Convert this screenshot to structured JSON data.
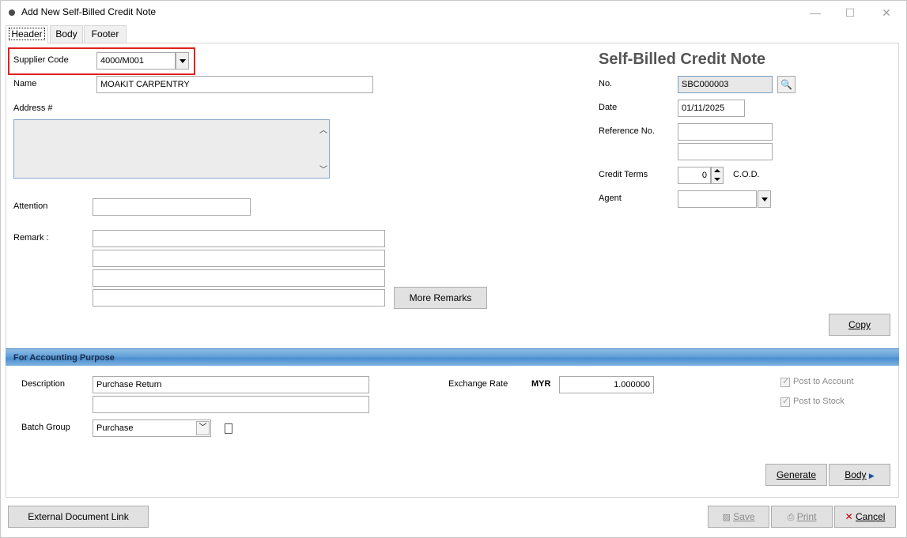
{
  "window": {
    "title": "Add New Self-Billed Credit Note",
    "minimize": "—",
    "maximize": "☐",
    "close": "✕"
  },
  "tabs": [
    {
      "label": "Header",
      "active": true
    },
    {
      "label": "Body",
      "active": false
    },
    {
      "label": "Footer",
      "active": false
    }
  ],
  "header": {
    "doc_title": "Self-Billed Credit Note",
    "supplier_code_label": "Supplier Code",
    "supplier_code_value": "4000/M001",
    "name_label": "Name",
    "name_value": "MOAKIT CARPENTRY",
    "address_label": "Address #",
    "attention_label": "Attention",
    "remark_label": "Remark :",
    "more_remarks_label": "More Remarks",
    "no_label": "No.",
    "no_value": "SBC000003",
    "date_label": "Date",
    "date_value": "01/11/2025",
    "reference_label": "Reference No.",
    "credit_terms_label": "Credit Terms",
    "credit_terms_value": "0",
    "credit_terms_desc": "C.O.D.",
    "agent_label": "Agent",
    "copy_label": "Copy"
  },
  "accounting": {
    "section_title": "For Accounting Purpose",
    "description_label": "Description",
    "description_value": "Purchase Return",
    "batch_group_label": "Batch Group",
    "batch_group_value": "Purchase",
    "exchange_rate_label": "Exchange Rate",
    "currency": "MYR",
    "exchange_rate_value": "1.000000",
    "post_to_account_label": "Post to Account",
    "post_to_stock_label": "Post to Stock",
    "post_to_account_checked": true,
    "post_to_stock_checked": true,
    "generate_label": "Generate",
    "body_label": "Body"
  },
  "footer": {
    "external_link_label": "External Document Link",
    "save_label": "Save",
    "print_label": "Print",
    "cancel_label": "Cancel"
  },
  "colors": {
    "section_bar": "#5f9fd8",
    "highlight": "#e02020",
    "cancel_icon": "#cc0000"
  }
}
